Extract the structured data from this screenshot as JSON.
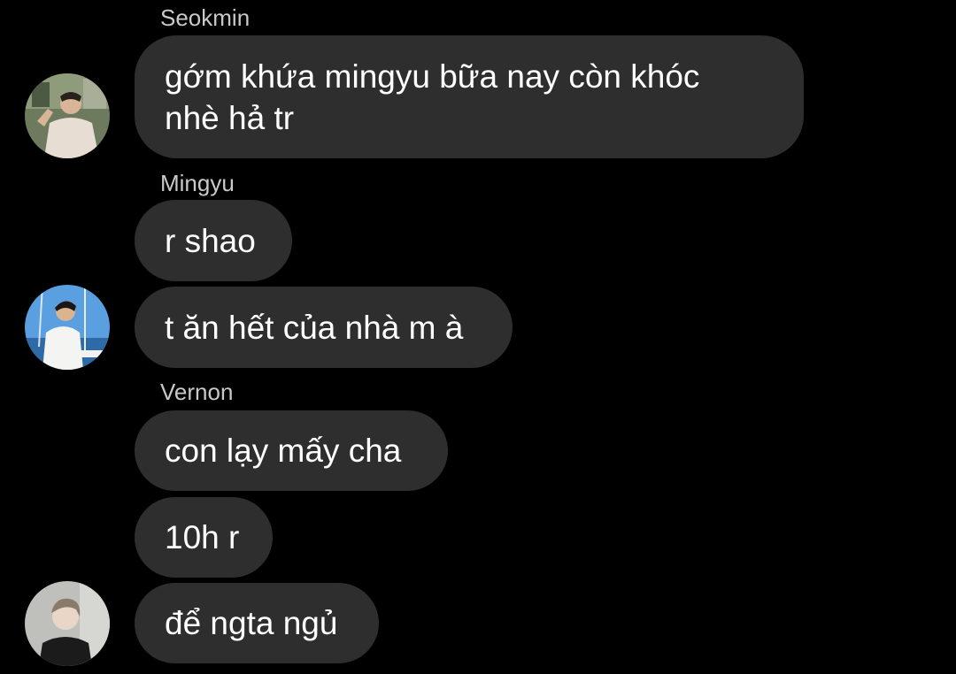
{
  "messages": {
    "seokmin": {
      "name": "Seokmin",
      "text1": "gớm khứa mingyu bữa nay còn khóc",
      "text2": "nhè hả tr",
      "avatar": "seokmin-avatar"
    },
    "mingyu": {
      "name": "Mingyu",
      "msg1": "r shao",
      "msg2": "t ăn hết của nhà m à",
      "avatar": "mingyu-avatar"
    },
    "vernon": {
      "name": "Vernon",
      "msg1": "con lạy mấy cha",
      "msg2": "10h r",
      "msg3": "để ngta ngủ",
      "avatar": "vernon-avatar"
    }
  },
  "colors": {
    "background": "#000000",
    "bubble": "#2e2e2e",
    "sender_name": "#c9c9c9",
    "text": "#ffffff"
  }
}
